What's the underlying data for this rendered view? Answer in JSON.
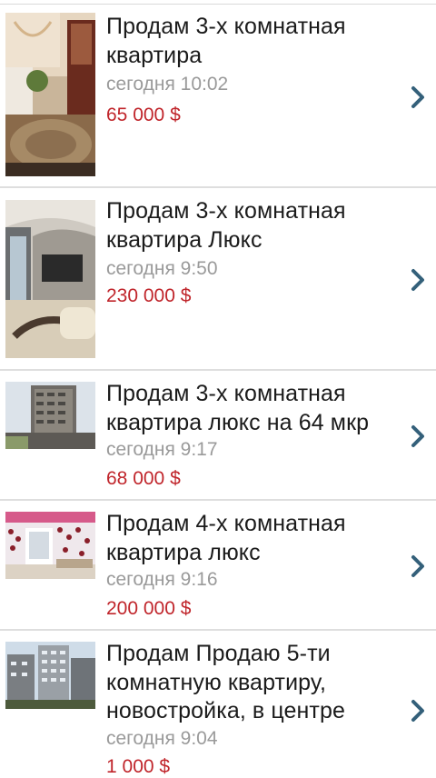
{
  "listings": [
    {
      "title": "Продам 3-х комнатная квартира",
      "date": "сегодня 10:02",
      "price": "65 000 $"
    },
    {
      "title": "Продам 3-х комнатная квартира Люкс",
      "date": "сегодня 9:50",
      "price": "230 000 $"
    },
    {
      "title": "Продам 3-х комнатная квартира люкс на 64 мкр",
      "date": "сегодня 9:17",
      "price": "68 000 $"
    },
    {
      "title": "Продам 4-х комнатная квартира люкс",
      "date": "сегодня 9:16",
      "price": "200 000 $"
    },
    {
      "title": "Продам Продаю 5-ти комнатную квартиру, новостройка, в центре",
      "date": "сегодня 9:04",
      "price": "1 000 $"
    }
  ],
  "icons": {
    "row_arrow": "chevron-right-icon"
  },
  "colors": {
    "price": "#c0252b",
    "date": "#9a9a9a",
    "chevron": "#34607a",
    "divider": "#dedede"
  }
}
